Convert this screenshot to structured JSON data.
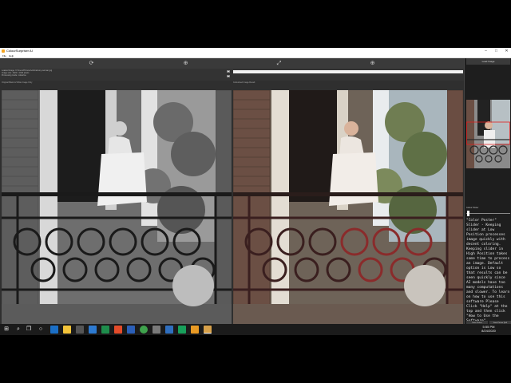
{
  "window": {
    "title": "ColourSurpriser AI",
    "controls": [
      "–",
      "□",
      "✕"
    ]
  },
  "menu": [
    "File",
    "Help"
  ],
  "toolbar_icons": [
    "rotate-icon",
    "zoom-in-icon",
    "expand-icon",
    "zoom-in-icon"
  ],
  "info": {
    "text": "Loaded image: C:\\Users\\Pictures\\old-balcony-woman.jpg\nImage size: 1024 x 1024 pixels\nProcessing mode: colourise"
  },
  "progress": 1.0,
  "panes": {
    "left_label": "Original Black & White Image Only",
    "right_label": "Colourised Image Result"
  },
  "sidebar": {
    "load_button": "Load Image",
    "slider_label": "Colour Poster",
    "description": "\"Color Poster\" Slider - Keeping slider at Low Position processes image quickly with decent coloring. Keeping slider in High Position takes some time to process an image. Default option is Low so that results can be seen quickly since AI models have too many computations and slower. To learn on how to use this software Please Click \"Help\" at the top and then click \"How to Use the Software\" www.pixbim.com",
    "save_button": "Save Picture\n(Full Image)",
    "save_crop_button": "Save Picture (Full\nImage with Crop)"
  },
  "taskbar": {
    "time": "5:55 PM",
    "date": "8/24/2020"
  }
}
